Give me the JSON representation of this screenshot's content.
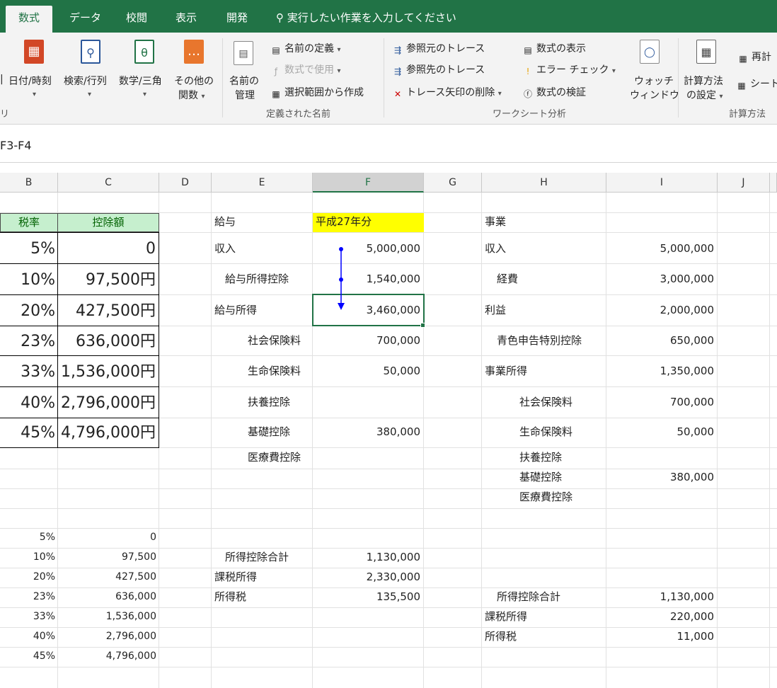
{
  "tabs": [
    {
      "label": "数式",
      "active": true
    },
    {
      "label": "データ"
    },
    {
      "label": "校閲"
    },
    {
      "label": "表示"
    },
    {
      "label": "開発"
    }
  ],
  "tell_me": "実行したい作業を入力してください",
  "ribbon": {
    "library": {
      "date_time": "日付/時刻",
      "lookup": "検索/行列",
      "math": "数学/三角",
      "other_line1": "その他の",
      "other_line2": "関数",
      "group_label": "リ"
    },
    "names": {
      "manager_line1": "名前の",
      "manager_line2": "管理",
      "define_name": "名前の定義",
      "use_in_formula": "数式で使用",
      "create_from_selection": "選択範囲から作成",
      "group_label": "定義された名前"
    },
    "audit": {
      "trace_precedents": "参照元のトレース",
      "trace_dependents": "参照先のトレース",
      "remove_arrows": "トレース矢印の削除",
      "show_formulas": "数式の表示",
      "error_checking": "エラー チェック",
      "evaluate_formula": "数式の検証",
      "watch_line1": "ウォッチ",
      "watch_line2": "ウィンドウ",
      "group_label": "ワークシート分析"
    },
    "calc": {
      "options_line1": "計算方法",
      "options_line2": "の設定",
      "recalc": "再計",
      "sheet": "シート",
      "group_label": "計算方法"
    }
  },
  "formula_bar": "F3-F4",
  "columns": [
    "B",
    "C",
    "D",
    "E",
    "F",
    "G",
    "H",
    "I",
    "J"
  ],
  "rate_table": {
    "header_rate": "税率",
    "header_deduction": "控除額",
    "rows": [
      {
        "rate": "5%",
        "deduction": "0"
      },
      {
        "rate": "10%",
        "deduction": "97,500円"
      },
      {
        "rate": "20%",
        "deduction": "427,500円"
      },
      {
        "rate": "23%",
        "deduction": "636,000円"
      },
      {
        "rate": "33%",
        "deduction": "1,536,000円"
      },
      {
        "rate": "40%",
        "deduction": "2,796,000円"
      },
      {
        "rate": "45%",
        "deduction": "4,796,000円"
      }
    ]
  },
  "salary": {
    "title": "給与",
    "year_badge": "平成27年分",
    "income_label": "収入",
    "income": "5,000,000",
    "salary_deduction_label": "給与所得控除",
    "salary_deduction": "1,540,000",
    "salary_income_label": "給与所得",
    "salary_income": "3,460,000",
    "social_label": "社会保険料",
    "social": "700,000",
    "life_label": "生命保険料",
    "life": "50,000",
    "dependent_label": "扶養控除",
    "basic_label": "基礎控除",
    "basic": "380,000",
    "medical_label": "医療費控除",
    "total_deduction_label": "所得控除合計",
    "total_deduction": "1,130,000",
    "taxable_label": "課税所得",
    "taxable": "2,330,000",
    "tax_label": "所得税",
    "tax": "135,500"
  },
  "business": {
    "title": "事業",
    "income_label": "収入",
    "income": "5,000,000",
    "expense_label": "経費",
    "expense": "3,000,000",
    "profit_label": "利益",
    "profit": "2,000,000",
    "blue_label": "青色申告特別控除",
    "blue": "650,000",
    "biz_income_label": "事業所得",
    "biz_income": "1,350,000",
    "social_label": "社会保険料",
    "social": "700,000",
    "life_label": "生命保険料",
    "life": "50,000",
    "dependent_label": "扶養控除",
    "basic_label": "基礎控除",
    "basic": "380,000",
    "medical_label": "医療費控除",
    "total_deduction_label": "所得控除合計",
    "total_deduction": "1,130,000",
    "taxable_label": "課税所得",
    "taxable": "220,000",
    "tax_label": "所得税",
    "tax": "11,000"
  },
  "plain_table": [
    {
      "rate": "5%",
      "deduction": "0"
    },
    {
      "rate": "10%",
      "deduction": "97,500"
    },
    {
      "rate": "20%",
      "deduction": "427,500"
    },
    {
      "rate": "23%",
      "deduction": "636,000"
    },
    {
      "rate": "33%",
      "deduction": "1,536,000"
    },
    {
      "rate": "40%",
      "deduction": "2,796,000"
    },
    {
      "rate": "45%",
      "deduction": "4,796,000"
    }
  ],
  "colors": {
    "excel_green": "#217346",
    "header_green": "#c6efce",
    "badge_yellow": "#ffff00",
    "arrow_blue": "#0000ff"
  }
}
